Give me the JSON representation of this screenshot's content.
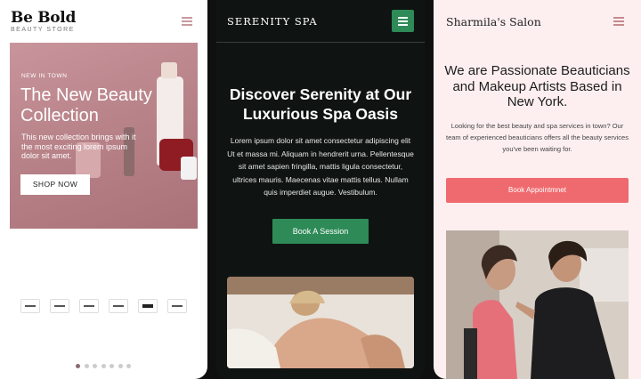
{
  "card1": {
    "logo": "Be Bold",
    "logo_sub": "BEAUTY STORE",
    "eyebrow": "NEW IN TOWN",
    "headline": "The New Beauty Collection",
    "body": "This new collection brings with it the most exciting lorem ipsum dolor sit amet.",
    "button": "SHOP NOW",
    "brand_logos": [
      "brand-logo-1",
      "brand-logo-2",
      "brand-logo-3",
      "brand-logo-4",
      "brand-logo-5",
      "brand-logo-6"
    ],
    "carousel_dots": 7,
    "active_dot": 0
  },
  "card2": {
    "logo": "SERENITY SPA",
    "headline": "Discover Serenity at Our Luxurious Spa Oasis",
    "body": "Lorem ipsum dolor sit amet consectetur adipiscing elit Ut et massa mi. Aliquam in hendrerit urna. Pellentesque sit amet sapien fringilla, mattis ligula consectetur, ultrices mauris. Maecenas vitae mattis tellus. Nullam quis imperdiet augue. Vestibulum.",
    "button": "Book A Session",
    "accent": "#2e8a57"
  },
  "card3": {
    "logo": "Sharmila's Salon",
    "headline": "We are Passionate Beauticians and Makeup Artists Based in New York.",
    "body": "Looking for the best beauty and spa services in town? Our team of experienced beauticians offers all the beauty services you've been waiting for.",
    "button": "Book Appointmnet",
    "accent": "#ef6a6e"
  }
}
